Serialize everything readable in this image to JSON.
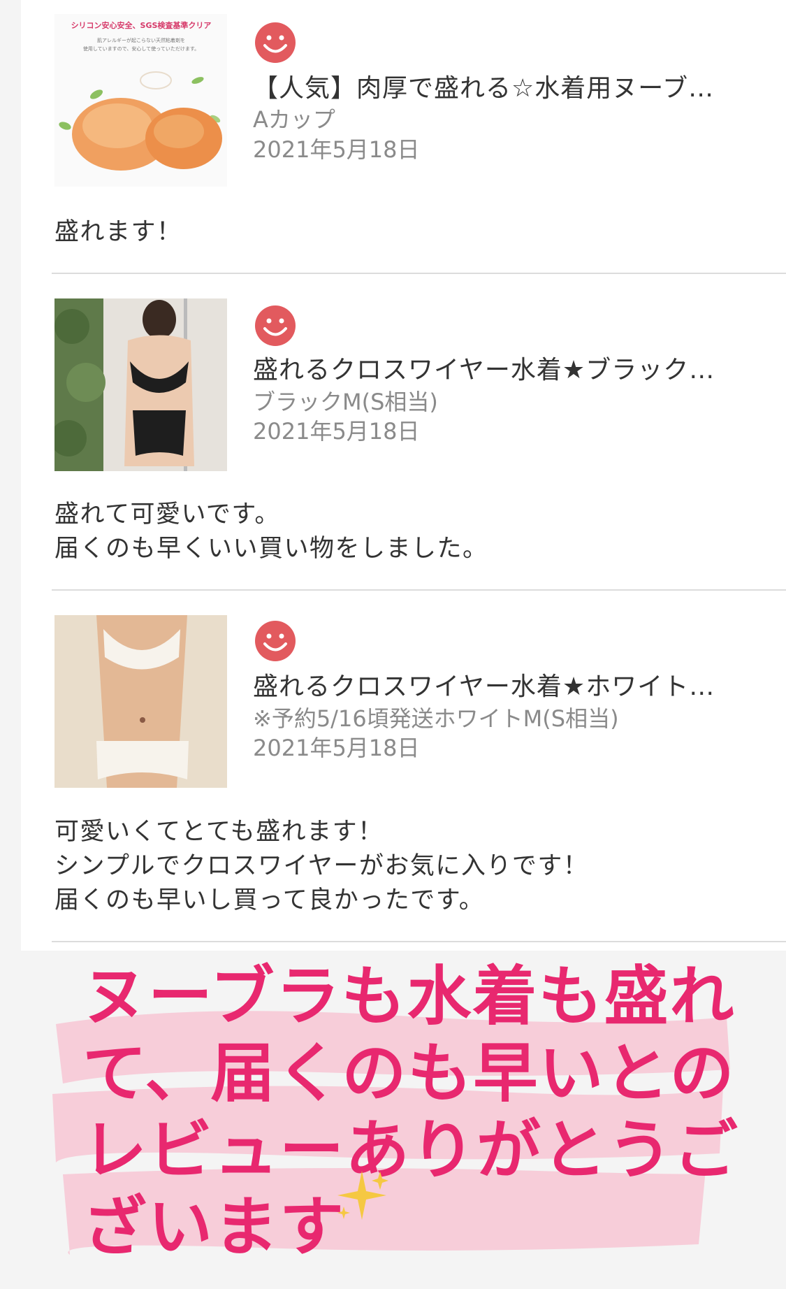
{
  "reviews": [
    {
      "thumb_banner": "シリコン安心安全、SGS検査基準クリア",
      "thumb_sub1": "肌アレルギーが起こらない天然粘着剤を",
      "thumb_sub2": "使用していますので、安心して使っていただけます。",
      "title": "【人気】肉厚で盛れる☆水着用ヌーブ…",
      "variant": "Aカップ",
      "date": "2021年5月18日",
      "body": [
        "盛れます！"
      ]
    },
    {
      "title": "盛れるクロスワイヤー水着★ブラック…",
      "variant": "ブラックM(S相当)",
      "date": "2021年5月18日",
      "body": [
        "盛れて可愛いです。",
        "届くのも早くいい買い物をしました。"
      ]
    },
    {
      "title": "盛れるクロスワイヤー水着★ホワイト…",
      "variant": "※予約5/16頃発送ホワイトM(S相当)",
      "date": "2021年5月18日",
      "body": [
        "可愛いくてとても盛れます！",
        "シンプルでクロスワイヤーがお気に入りです！",
        "届くのも早いし買って良かったです。"
      ]
    }
  ],
  "caption": {
    "lines": [
      "ヌーブラも水着も盛れ",
      "て、届くのも早いとの",
      "レビューありがとうご",
      "ざいます"
    ],
    "color": "#e8286f",
    "brush_color": "#f7c6d3"
  },
  "icons": {
    "rating": "smiley-icon",
    "sparkle": "sparkle-icon"
  },
  "colors": {
    "smiley": "#e25a5e",
    "text": "#333333",
    "muted": "#8a8a8a"
  }
}
